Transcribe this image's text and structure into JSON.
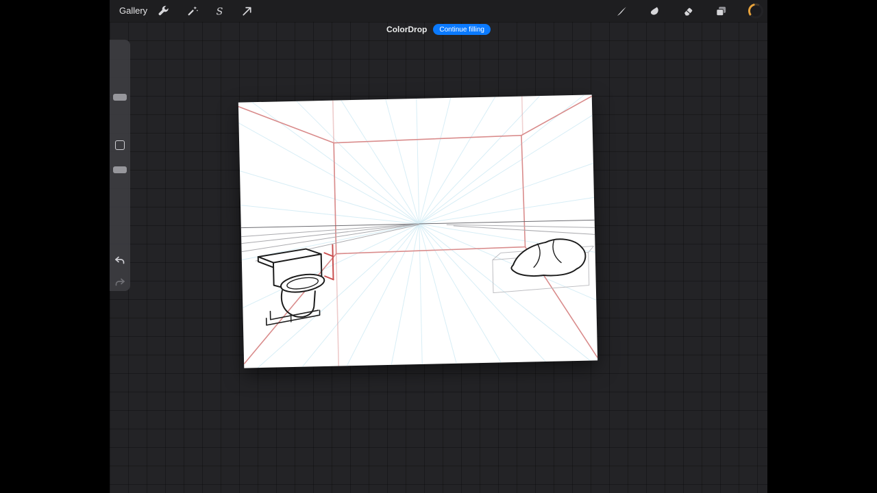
{
  "topbar": {
    "gallery_label": "Gallery",
    "selection_glyph": "S",
    "left_icons": [
      "actions-wrench-icon",
      "adjustments-wand-icon",
      "selection-s-icon",
      "transform-arrow-icon"
    ],
    "right_icons": [
      "paint-brush-icon",
      "smudge-icon",
      "erase-icon",
      "layers-icon",
      "color-swatch"
    ]
  },
  "banner": {
    "title": "ColorDrop",
    "button_label": "Continue filling",
    "button_color": "#0a7aff"
  },
  "sidebar": {
    "controls": [
      "brush-size-slider",
      "modify-button",
      "opacity-slider",
      "undo-button",
      "redo-button"
    ]
  },
  "workspace": {
    "canvas_content": "one-point perspective room sketch: red wall construction, blue vanishing guides, toilet at left, rock at right"
  },
  "colors": {
    "letterbox": "#000000",
    "toolbar_bg": "#1e1e20",
    "workspace_bg": "#232326",
    "canvas_bg": "#ffffff",
    "accent_blue": "#0a7aff",
    "swatch_ring": "#e8a23b"
  }
}
